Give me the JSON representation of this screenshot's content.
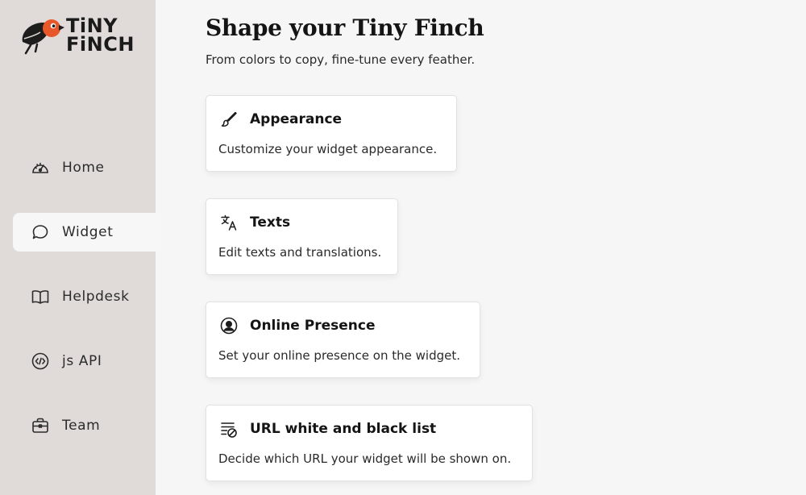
{
  "brand": {
    "line1": "TiNY",
    "line2": "FiNCH"
  },
  "sidebar": {
    "items": [
      {
        "label": "Home",
        "icon": "gauge-icon"
      },
      {
        "label": "Widget",
        "icon": "chat-bubble-icon",
        "active": true
      },
      {
        "label": "Helpdesk",
        "icon": "book-icon"
      },
      {
        "label": "js API",
        "icon": "code-icon"
      },
      {
        "label": "Team",
        "icon": "briefcase-icon"
      }
    ]
  },
  "main": {
    "title": "Shape your Tiny Finch",
    "subtitle": "From colors to copy, fine-tune every feather.",
    "cards": [
      {
        "title": "Appearance",
        "desc": "Customize your widget appearance.",
        "icon": "brush-icon"
      },
      {
        "title": "Texts",
        "desc": "Edit texts and translations.",
        "icon": "translate-icon"
      },
      {
        "title": "Online Presence",
        "desc": "Set your online presence on the widget.",
        "icon": "user-circle-icon"
      },
      {
        "title": "URL white and black list",
        "desc": "Decide which URL your widget will be shown on.",
        "icon": "list-block-icon"
      }
    ]
  },
  "colors": {
    "sidebar_bg": "#e0dbd8",
    "page_bg": "#f6f6f6",
    "logo_orange": "#e8572a"
  }
}
